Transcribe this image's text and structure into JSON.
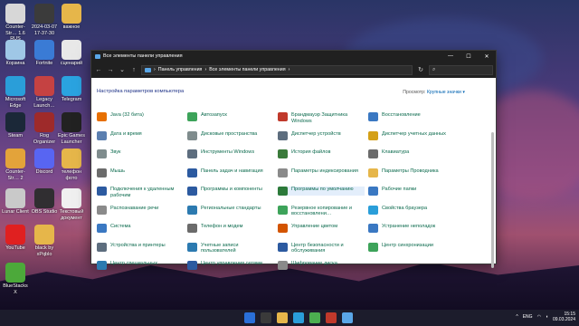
{
  "desktop": {
    "icons": [
      {
        "label": "Counter-Str… 1.6 RUS",
        "color": "#d7d7d7"
      },
      {
        "label": "2024-03-07 17-37-30",
        "color": "#3b3b3b"
      },
      {
        "label": "важное",
        "color": "#e6b64a"
      },
      {
        "label": "Корзина",
        "color": "#9fc7e6"
      },
      {
        "label": "Fortnite",
        "color": "#3a7bd5"
      },
      {
        "label": "сценарий",
        "color": "#e8e8e8"
      },
      {
        "label": "Microsoft Edge",
        "color": "#2a9ed9"
      },
      {
        "label": "Legacy Launch…",
        "color": "#c54242"
      },
      {
        "label": "Telegram",
        "color": "#2aa3e0"
      },
      {
        "label": "Steam",
        "color": "#1b2838"
      },
      {
        "label": "Rog Organizer",
        "color": "#9e2a2a"
      },
      {
        "label": "Epic Games Launcher",
        "color": "#222222"
      },
      {
        "label": "Counter-Str… 2",
        "color": "#e3a33a"
      },
      {
        "label": "Discord",
        "color": "#5865f2"
      },
      {
        "label": "телефон фото",
        "color": "#e6b64a"
      },
      {
        "label": "Lunar Client",
        "color": "#c9c9c9"
      },
      {
        "label": "OBS Studio",
        "color": "#302e31"
      },
      {
        "label": "Текстовый документ",
        "color": "#f0f0f0"
      },
      {
        "label": "YouTube",
        "color": "#e02020"
      },
      {
        "label": "black by xPqblo",
        "color": "#e6b64a"
      },
      {
        "label": "BlueStacks X",
        "color": "#4ca93a"
      }
    ]
  },
  "window": {
    "title": "Все элементы панели управления",
    "controls": {
      "minimize": "—",
      "maximize": "☐",
      "close": "✕"
    },
    "nav": {
      "back": "←",
      "forward": "→",
      "up_dropdown": "⌄",
      "up": "↑",
      "refresh": "↻",
      "search": "⌕"
    },
    "breadcrumb": [
      "Панель управления",
      "Все элементы панели управления"
    ],
    "heading": "Настройка параметров компьютера",
    "view_by_label": "Просмотр:",
    "view_by_value": "Крупные значки ▾",
    "items": [
      {
        "label": "Java (32 бита)",
        "color": "#e76f00"
      },
      {
        "label": "Автозапуск",
        "color": "#3da35a"
      },
      {
        "label": "Брандмауэр Защитника Windows",
        "color": "#c0392b"
      },
      {
        "label": "Восстановление",
        "color": "#3a78c2"
      },
      {
        "label": "Дата и время",
        "color": "#5b7fb0"
      },
      {
        "label": "Дисковые пространства",
        "color": "#7f8c8d"
      },
      {
        "label": "Диспетчер устройств",
        "color": "#5d6d7e"
      },
      {
        "label": "Диспетчер учетных данных",
        "color": "#d4a017"
      },
      {
        "label": "Звук",
        "color": "#7f8c8d"
      },
      {
        "label": "Инструменты Windows",
        "color": "#5d6d7e"
      },
      {
        "label": "История файлов",
        "color": "#3a7a3a"
      },
      {
        "label": "Клавиатура",
        "color": "#6b6b6b"
      },
      {
        "label": "Мышь",
        "color": "#6b6b6b"
      },
      {
        "label": "Панель задач и навигация",
        "color": "#2c5aa0"
      },
      {
        "label": "Параметры индексирования",
        "color": "#8a8a8a"
      },
      {
        "label": "Параметры Проводника",
        "color": "#e6b64a"
      },
      {
        "label": "Подключения к удаленным рабочим",
        "color": "#2c5aa0"
      },
      {
        "label": "Программы и компоненты",
        "color": "#2c5aa0"
      },
      {
        "label": "Программы по умолчанию",
        "color": "#2c7a3a"
      },
      {
        "label": "Рабочие папки",
        "color": "#3a78c2"
      },
      {
        "label": "Распознавание речи",
        "color": "#8a8a8a"
      },
      {
        "label": "Региональные стандарты",
        "color": "#2c7ab0"
      },
      {
        "label": "Резервное копирование и восстановлени…",
        "color": "#3da35a"
      },
      {
        "label": "Свойства браузера",
        "color": "#2a9ed9"
      },
      {
        "label": "Система",
        "color": "#3a78c2"
      },
      {
        "label": "Телефон и модем",
        "color": "#6b6b6b"
      },
      {
        "label": "Управление цветом",
        "color": "#d35400"
      },
      {
        "label": "Устранение неполадок",
        "color": "#3a78c2"
      },
      {
        "label": "Устройства и принтеры",
        "color": "#5d6d7e"
      },
      {
        "label": "Учетные записи пользователей",
        "color": "#2c7ab0"
      },
      {
        "label": "Центр безопасности и обслуживания",
        "color": "#2c5aa0"
      },
      {
        "label": "Центр синхронизации",
        "color": "#3da35a"
      },
      {
        "label": "Центр специальных",
        "color": "#2c7ab0"
      },
      {
        "label": "Центр управления сетями",
        "color": "#2c5aa0"
      },
      {
        "label": "Шифрование диска",
        "color": "#8a8a8a"
      }
    ]
  },
  "taskbar": {
    "icons": [
      "#2a6fd8",
      "#3a3a3a",
      "#e6b64a",
      "#2a9ed9",
      "#4caf50",
      "#c0392b",
      "#5aa7e8"
    ],
    "language": "ENG",
    "time": "15:15",
    "date": "09.03.2024"
  }
}
